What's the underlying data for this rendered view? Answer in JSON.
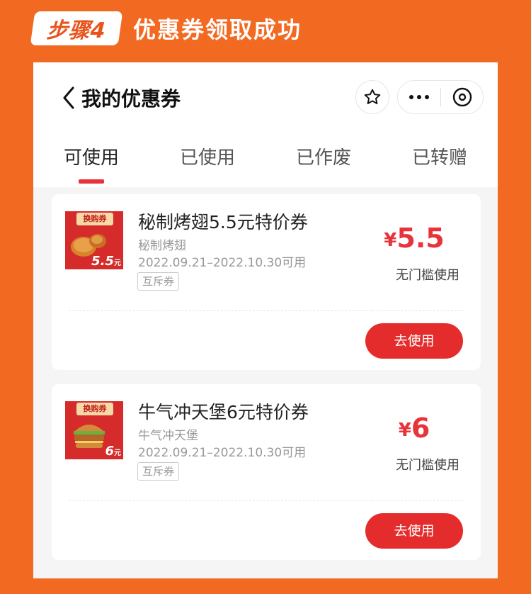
{
  "step": {
    "badge": "步骤4",
    "title": "优惠券领取成功"
  },
  "navbar": {
    "title": "我的优惠券"
  },
  "tabs": [
    {
      "label": "可使用",
      "active": true
    },
    {
      "label": "已使用",
      "active": false
    },
    {
      "label": "已作废",
      "active": false
    },
    {
      "label": "已转赠",
      "active": false
    }
  ],
  "coupons": [
    {
      "thumb_tag": "换购券",
      "thumb_price": "5.5",
      "thumb_unit": "元",
      "name": "秘制烤翅5.5元特价券",
      "sub": "秘制烤翅",
      "date": "2022.09.21–2022.10.30可用",
      "badge": "互斥券",
      "currency": "¥",
      "amount": "5.5",
      "condition": "无门槛使用",
      "button": "去使用"
    },
    {
      "thumb_tag": "换购券",
      "thumb_price": "6",
      "thumb_unit": "元",
      "name": "牛气冲天堡6元特价券",
      "sub": "牛气冲天堡",
      "date": "2022.09.21–2022.10.30可用",
      "badge": "互斥券",
      "currency": "¥",
      "amount": "6",
      "condition": "无门槛使用",
      "button": "去使用"
    }
  ],
  "colors": {
    "background": "#f26a22",
    "accent": "#e8333a",
    "button": "#e52c2c"
  }
}
